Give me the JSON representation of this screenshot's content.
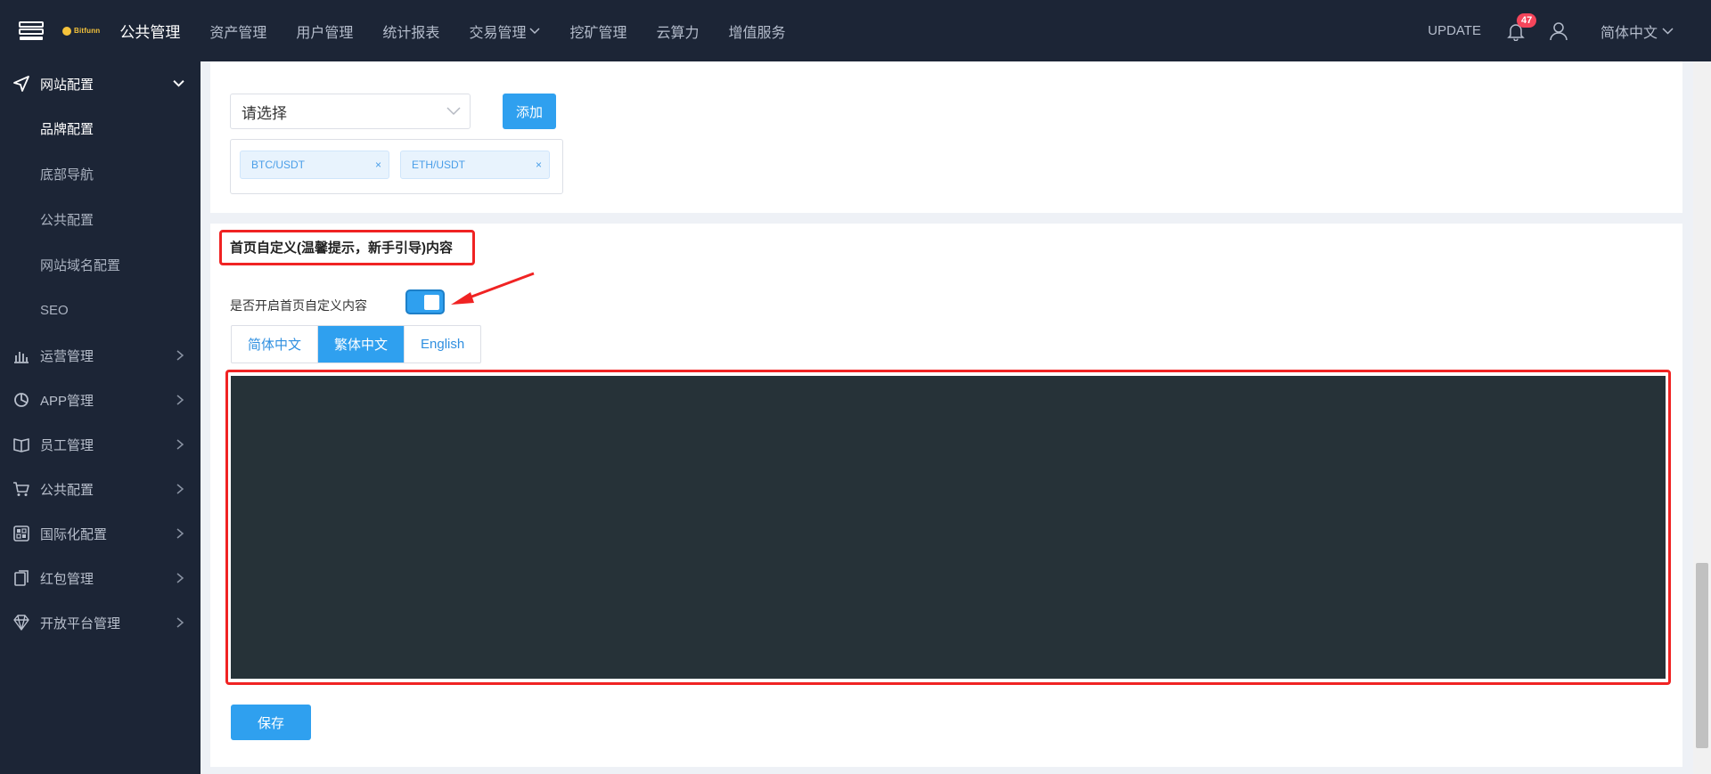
{
  "topbar": {
    "logo_text": "Bitfunn",
    "nav": [
      {
        "label": "公共管理",
        "active": true
      },
      {
        "label": "资产管理"
      },
      {
        "label": "用户管理"
      },
      {
        "label": "统计报表"
      },
      {
        "label": "交易管理",
        "dropdown": true
      },
      {
        "label": "挖矿管理"
      },
      {
        "label": "云算力"
      },
      {
        "label": "增值服务"
      }
    ],
    "update_label": "UPDATE",
    "notification_count": "47",
    "language": "简体中文"
  },
  "sidebar": {
    "open_group": {
      "label": "网站配置",
      "icon": "send-icon"
    },
    "sub_items": [
      {
        "label": "品牌配置",
        "active": true
      },
      {
        "label": "底部导航"
      },
      {
        "label": "公共配置"
      },
      {
        "label": "网站域名配置"
      },
      {
        "label": "SEO"
      }
    ],
    "groups": [
      {
        "label": "运营管理",
        "icon": "bar-chart-icon"
      },
      {
        "label": "APP管理",
        "icon": "pie-icon"
      },
      {
        "label": "员工管理",
        "icon": "book-icon"
      },
      {
        "label": "公共配置",
        "icon": "cart-icon"
      },
      {
        "label": "国际化配置",
        "icon": "grid-icon"
      },
      {
        "label": "红包管理",
        "icon": "clipboard-icon"
      },
      {
        "label": "开放平台管理",
        "icon": "diamond-icon"
      }
    ]
  },
  "pairs_card": {
    "select_placeholder": "请选择",
    "add_label": "添加",
    "tags": [
      "BTC/USDT",
      "ETH/USDT"
    ]
  },
  "custom_card": {
    "title": "首页自定义(温馨提示，新手引导)内容",
    "switch_label": "是否开启首页自定义内容",
    "switch_on": true,
    "tabs": [
      {
        "label": "简体中文"
      },
      {
        "label": "繁体中文",
        "active": true
      },
      {
        "label": "English"
      }
    ],
    "save_label": "保存"
  },
  "colors": {
    "accent": "#2fa0ef",
    "sidebar_bg": "#1c2536",
    "editor_bg": "#263238",
    "annotation": "#f02323",
    "badge": "#f5455b"
  }
}
